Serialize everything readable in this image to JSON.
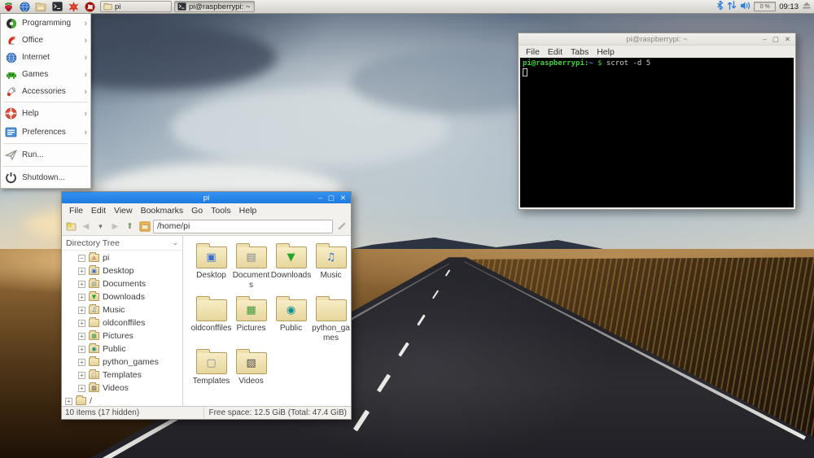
{
  "taskbar": {
    "launchers": [
      "menu-raspberry",
      "web-browser",
      "file-manager",
      "terminal",
      "wolfram",
      "mathematica"
    ],
    "tasks": [
      {
        "label": "pi",
        "icon": "folder"
      },
      {
        "label": "pi@raspberrypi: ~",
        "icon": "terminal"
      }
    ],
    "tray": {
      "icons": [
        "bluetooth",
        "network",
        "volume",
        "cpu-monitor",
        "clock",
        "eject"
      ],
      "cpu": "0 %",
      "clock": "09:13"
    }
  },
  "menu": {
    "items": [
      {
        "label": "Programming",
        "icon": "programming",
        "submenu": true
      },
      {
        "label": "Office",
        "icon": "office",
        "submenu": true
      },
      {
        "label": "Internet",
        "icon": "internet",
        "submenu": true
      },
      {
        "label": "Games",
        "icon": "games",
        "submenu": true
      },
      {
        "label": "Accessories",
        "icon": "accessories",
        "submenu": true
      },
      {
        "label": "Help",
        "icon": "help",
        "submenu": true
      },
      {
        "label": "Preferences",
        "icon": "preferences",
        "submenu": true
      },
      {
        "label": "Run...",
        "icon": "run",
        "submenu": false
      },
      {
        "label": "Shutdown...",
        "icon": "shutdown",
        "submenu": false
      }
    ]
  },
  "file_manager": {
    "title": "pi",
    "menu": [
      "File",
      "Edit",
      "View",
      "Bookmarks",
      "Go",
      "Tools",
      "Help"
    ],
    "path": "/home/pi",
    "sidebar_mode": "Directory Tree",
    "tree": [
      {
        "label": "pi",
        "expander": "−",
        "emblem": "⌂",
        "emblem_style": "color:#c0392b"
      },
      {
        "label": "Desktop",
        "expander": "+",
        "emblem": "▣",
        "emblem_style": "color:#3b6fd4"
      },
      {
        "label": "Documents",
        "expander": "+",
        "emblem": "▤",
        "emblem_style": "color:#7d8691"
      },
      {
        "label": "Downloads",
        "expander": "+",
        "emblem": "▼",
        "emblem_style": "color:#27a327"
      },
      {
        "label": "Music",
        "expander": "+",
        "emblem": "♫",
        "emblem_style": "color:#2f6fd0"
      },
      {
        "label": "oldconffiles",
        "expander": "+",
        "emblem": "",
        "emblem_style": ""
      },
      {
        "label": "Pictures",
        "expander": "+",
        "emblem": "▦",
        "emblem_style": "color:#3f9b3f"
      },
      {
        "label": "Public",
        "expander": "+",
        "emblem": "◉",
        "emblem_style": "color:#0f8f8f"
      },
      {
        "label": "python_games",
        "expander": "+",
        "emblem": "",
        "emblem_style": ""
      },
      {
        "label": "Templates",
        "expander": "+",
        "emblem": "▢",
        "emblem_style": "color:#7d8691"
      },
      {
        "label": "Videos",
        "expander": "+",
        "emblem": "▨",
        "emblem_style": "color:#4a4a4a"
      },
      {
        "label": "/",
        "expander": "+",
        "emblem": "",
        "emblem_style": ""
      }
    ],
    "folders": [
      {
        "label": "Desktop",
        "emblem": "▣",
        "emblem_style": "color:#3b6fd4"
      },
      {
        "label": "Documents",
        "emblem": "▤",
        "emblem_style": "color:#7d8691"
      },
      {
        "label": "Downloads",
        "emblem": "▼",
        "emblem_style": "color:#27a327"
      },
      {
        "label": "Music",
        "emblem": "♫",
        "emblem_style": "color:#2f6fd0"
      },
      {
        "label": "oldconffiles",
        "emblem": "",
        "emblem_style": ""
      },
      {
        "label": "Pictures",
        "emblem": "▦",
        "emblem_style": "color:#3f9b3f"
      },
      {
        "label": "Public",
        "emblem": "◉",
        "emblem_style": "color:#0f8f8f"
      },
      {
        "label": "python_games",
        "emblem": "",
        "emblem_style": ""
      },
      {
        "label": "Templates",
        "emblem": "▢",
        "emblem_style": "color:#7d8691"
      },
      {
        "label": "Videos",
        "emblem": "▨",
        "emblem_style": "color:#4a4a4a"
      }
    ],
    "status_left": "10 items (17 hidden)",
    "status_right": "Free space: 12.5 GiB (Total: 47.4 GiB)"
  },
  "terminal": {
    "title": "pi@raspberrypi: ~",
    "menu": [
      "File",
      "Edit",
      "Tabs",
      "Help"
    ],
    "prompt_user": "pi@raspberrypi",
    "prompt_colon": ":",
    "prompt_path": "~",
    "prompt_dollar": "$",
    "command": "scrot -d 5"
  },
  "colors": {
    "titlebar_active": "#2488ec",
    "selection_blue": "#2d7ce1",
    "terminal_green": "#3ad13a",
    "terminal_blue": "#7070ff",
    "folder_tan": "#efe1ae"
  }
}
